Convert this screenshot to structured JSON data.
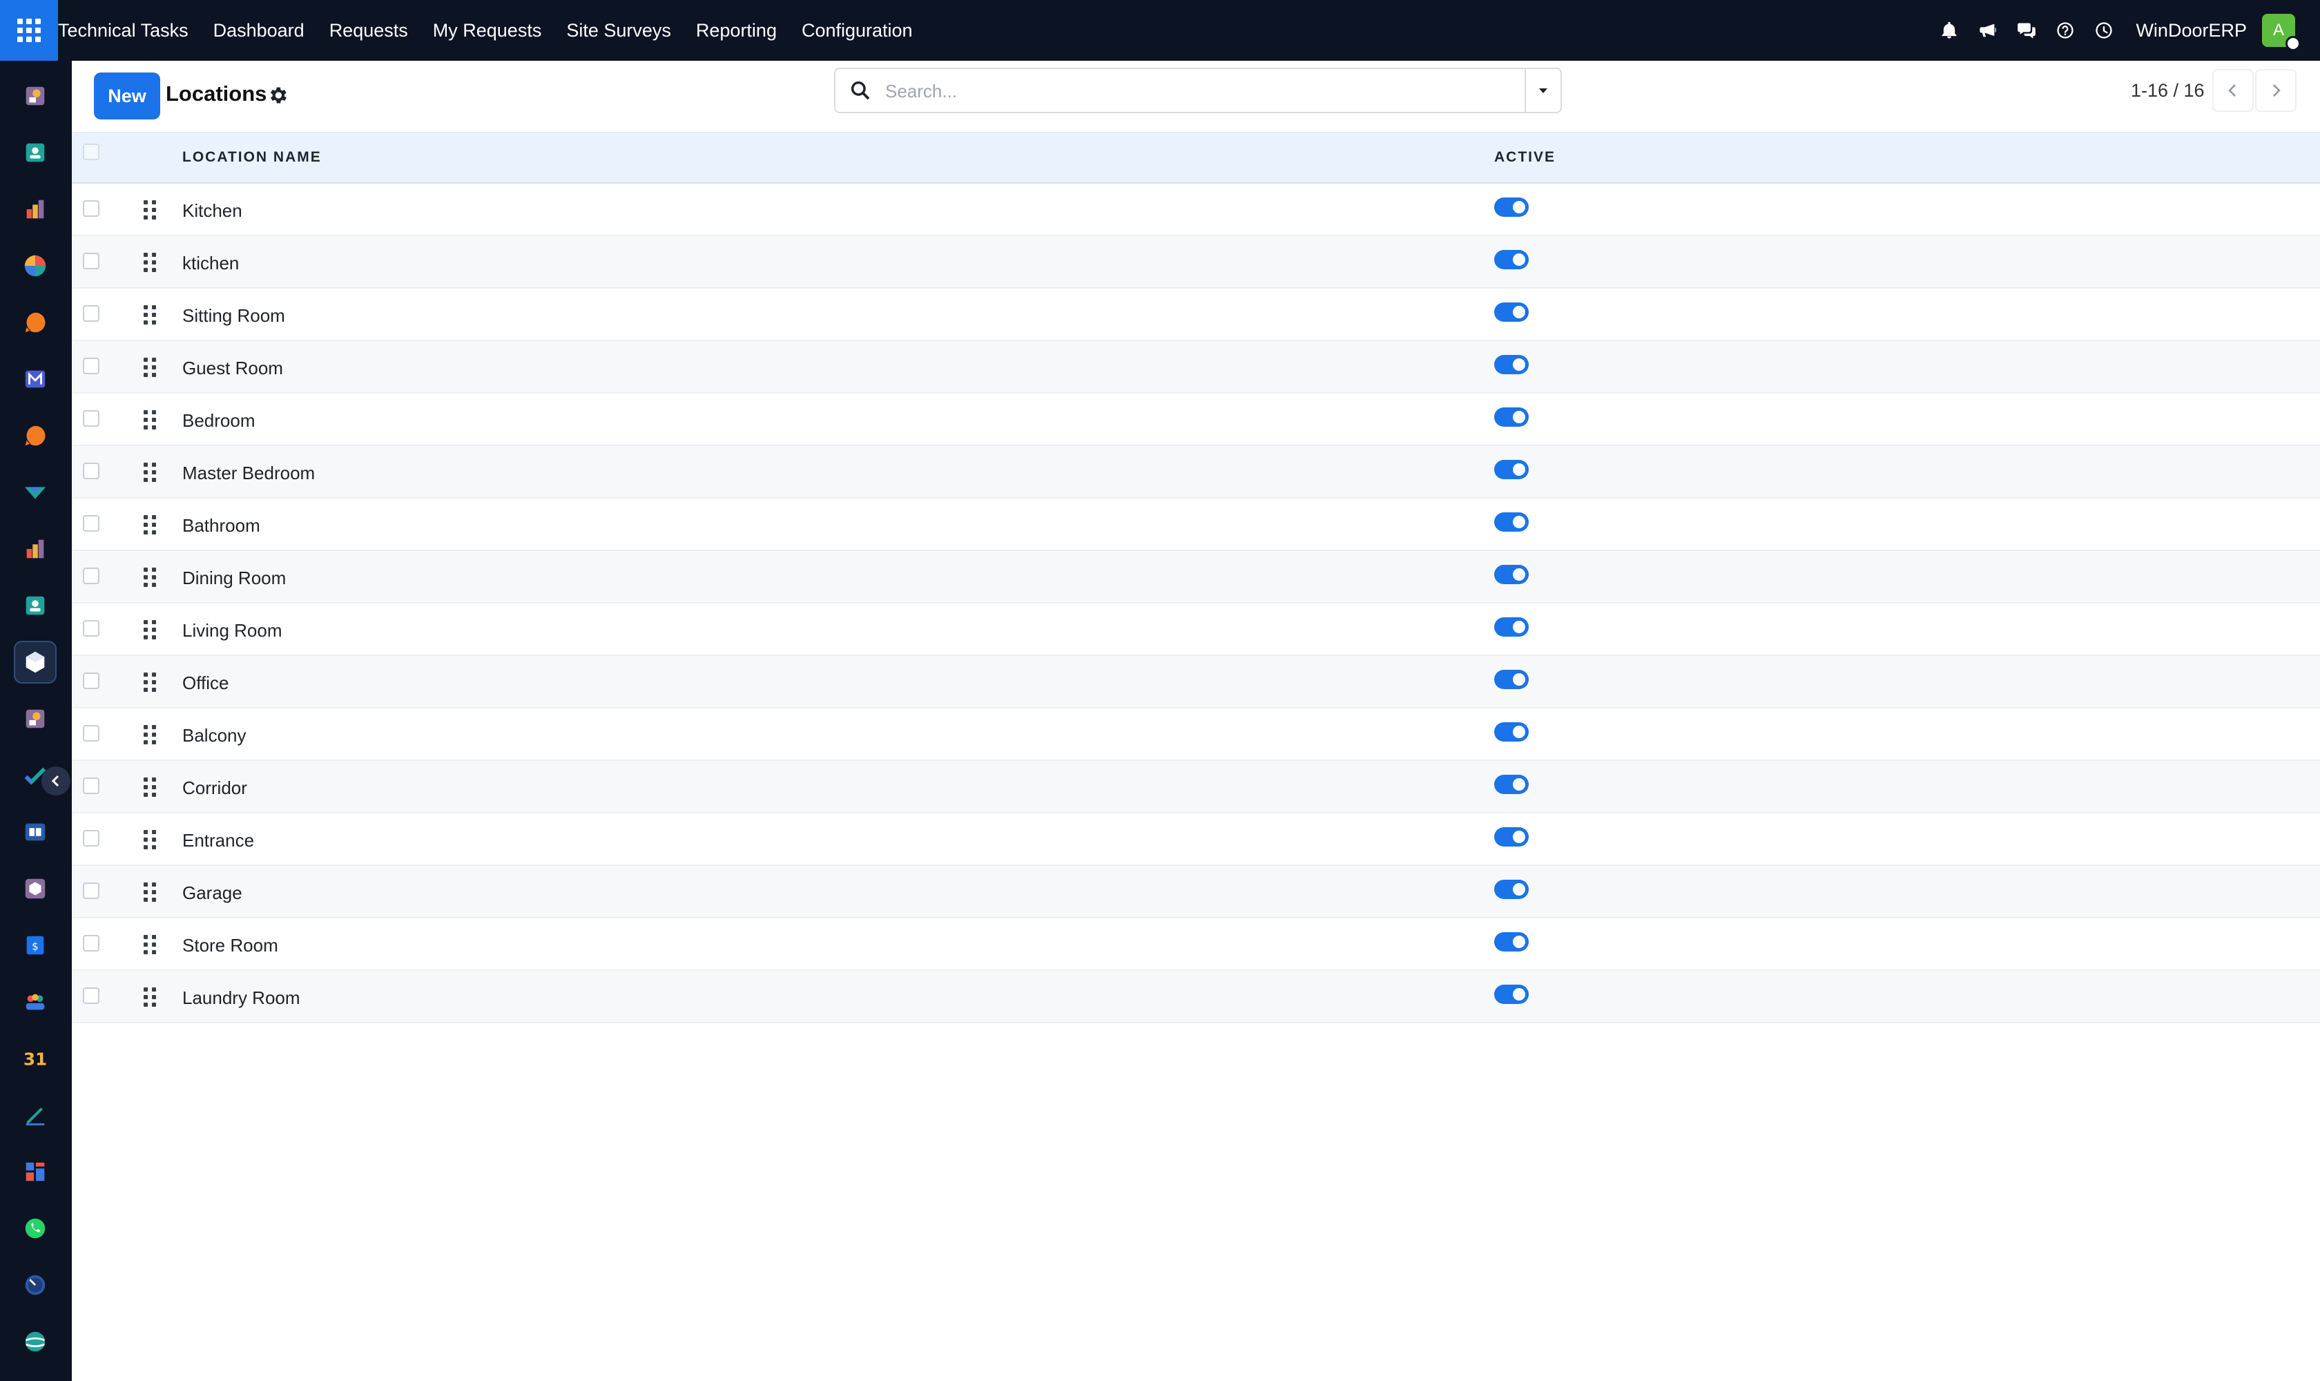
{
  "topbar": {
    "app_name": "Technical Tasks",
    "menu": [
      "Dashboard",
      "Requests",
      "My Requests",
      "Site Surveys",
      "Reporting",
      "Configuration"
    ],
    "company": "WinDoorERP",
    "avatar_initial": "A",
    "avatar_color": "#5ebd3e",
    "icons": [
      "bell-icon",
      "megaphone-icon",
      "chat-icon",
      "help-icon",
      "clock-icon"
    ]
  },
  "sidebar": {
    "apps": [
      "discuss",
      "contacts",
      "reporting",
      "dashboards",
      "livechat",
      "mail",
      "helpdesk",
      "surveys",
      "spreadsheet",
      "employees",
      "technical-tasks",
      "studio",
      "todo",
      "knowledge",
      "inventory",
      "expenses",
      "team",
      "calendar",
      "sign",
      "dashboard-builder",
      "whatsapp",
      "time-off",
      "website"
    ],
    "active_app": "technical-tasks"
  },
  "control_panel": {
    "new_label": "New",
    "title": "Locations",
    "search_placeholder": "Search...",
    "search_value": "",
    "pager": "1-16 / 16"
  },
  "list": {
    "columns": {
      "name": "LOCATION NAME",
      "active": "ACTIVE"
    },
    "rows": [
      {
        "name": "Kitchen",
        "active": true
      },
      {
        "name": "ktichen",
        "active": true
      },
      {
        "name": "Sitting Room",
        "active": true
      },
      {
        "name": "Guest Room",
        "active": true
      },
      {
        "name": "Bedroom",
        "active": true
      },
      {
        "name": "Master Bedroom",
        "active": true
      },
      {
        "name": "Bathroom",
        "active": true
      },
      {
        "name": "Dining Room",
        "active": true
      },
      {
        "name": "Living Room",
        "active": true
      },
      {
        "name": "Office",
        "active": true
      },
      {
        "name": "Balcony",
        "active": true
      },
      {
        "name": "Corridor",
        "active": true
      },
      {
        "name": "Entrance",
        "active": true
      },
      {
        "name": "Garage",
        "active": true
      },
      {
        "name": "Store Room",
        "active": true
      },
      {
        "name": "Laundry Room",
        "active": true
      }
    ]
  },
  "colors": {
    "topbar": "#0c1323",
    "primary": "#1a73e8",
    "header_bg": "#e9f2fd"
  }
}
